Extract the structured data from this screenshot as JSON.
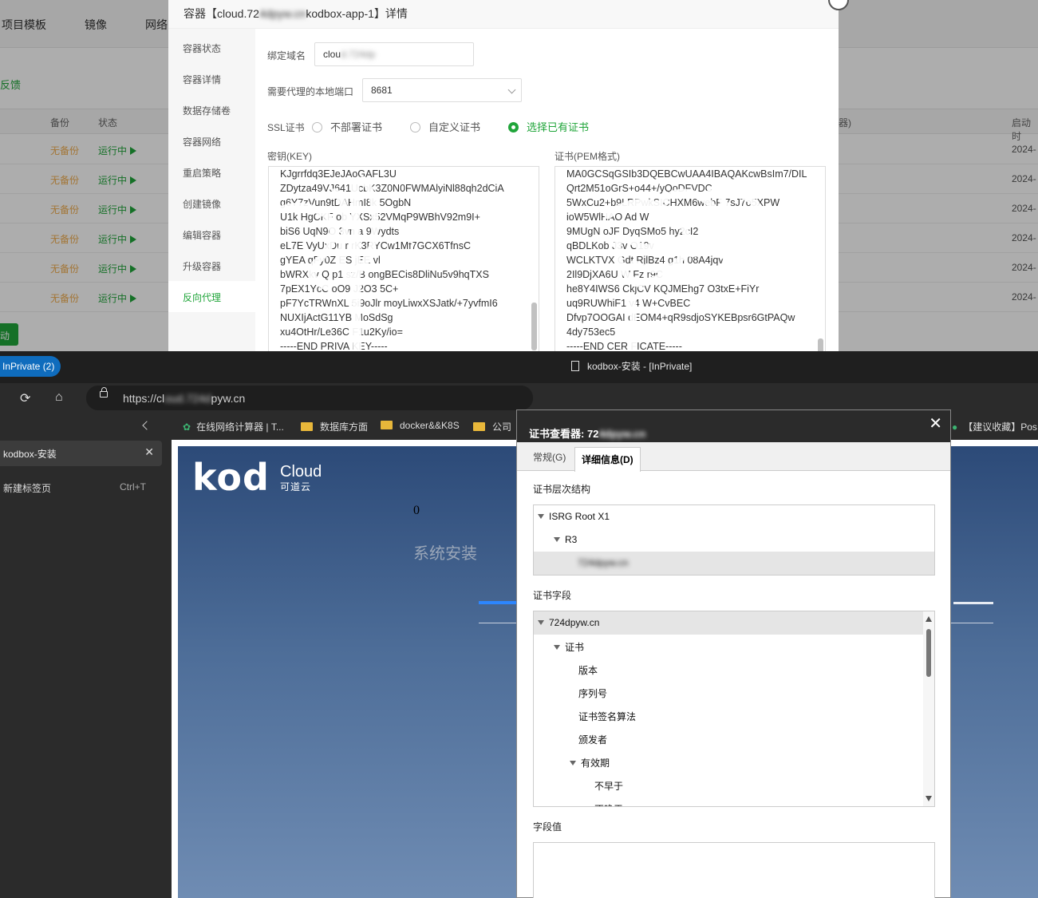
{
  "panel": {
    "nav": [
      "项目模板",
      "镜像",
      "网络"
    ],
    "feedback": "反馈",
    "table_headers": [
      "备份",
      "状态",
      "器)",
      "启动时"
    ],
    "rows": [
      {
        "backup": "无备份",
        "status": "运行中",
        "date": "2024-"
      },
      {
        "backup": "无备份",
        "status": "运行中",
        "date": "2024-"
      },
      {
        "backup": "无备份",
        "status": "运行中",
        "date": "2024-"
      },
      {
        "backup": "无备份",
        "status": "运行中",
        "date": "2024-"
      },
      {
        "backup": "无备份",
        "status": "运行中",
        "date": "2024-"
      },
      {
        "backup": "无备份",
        "status": "运行中",
        "date": "2024-"
      }
    ],
    "bottom_button": "动"
  },
  "modal": {
    "title_prefix": "容器【cloud.72",
    "title_blur": "4dpyw.cn",
    "title_suffix": "kodbox-app-1】详情",
    "sidebar": [
      "容器状态",
      "容器详情",
      "数据存储卷",
      "容器网络",
      "重启策略",
      "创建镜像",
      "编辑容器",
      "升级容器",
      "反向代理"
    ],
    "active_index": 8,
    "domain_label": "绑定域名",
    "domain_value_visible": "clou",
    "domain_value_blur": "d.724dp",
    "port_label": "需要代理的本地端口",
    "port_value": "8681",
    "ssl_label": "SSL证书",
    "ssl_options": [
      "不部署证书",
      "自定义证书",
      "选择已有证书"
    ],
    "ssl_selected": 2,
    "key_label": "密钥(KEY)",
    "key_lines": [
      "KJgrrfdq3EJeJAoGAFL3U",
      "ZDytza49VJ641UcbK3Z0N0FWMAlyiNl88qh2dCiA",
      "g6Y7zVun9tDAHmI8k  5OgbN",
      "  U1k  HgCKF  ob  YXSx52VMqP9WBhV92m9I+",
      "biS6  UqN9O  3vn  a  9Wydts",
      "eL7E  VyUxDu  r  rK3RYCw1Mf7GCX6TfnsC",
      "gYEA  qFy0Z  ES  jEE  vl",
      "bWRXkv  Q  p1  sz/B  ongBECis8DliNu5v9hqTXS",
      "7pEX1YcC  oO9  J2O3  5C+",
      "pF7YcTRWnXL  5i9oJlr moyLiwxXSJatk/+7yvfmI6",
      "NUXIjActG11YB  MoSdSg",
      "xu4OtHr/Le36C  F1u2Ky/io=",
      "-----END PRIVA  KEY-----"
    ],
    "cert_label": "证书(PEM格式)",
    "cert_lines": [
      "MA0GCSqGSIb3DQEBCwUAA4IBAQAKcwBsIm7/DIL",
      "Qrt2M51oGrS+o44+/yQoDFVDC",
      "5WxCu2+b9LRPwkSICHXM6webF  7sJ7o5XPW",
      "ioW5WlHAO  Ad  W",
      "9MUgN  oJF  DyqSMo5  hy2cI2",
      "qBDLKob  J3v  O19v",
      "WCLKTVX  Gdt  RjlBz4  g1h  08A4jqv",
      "2Il9DjXA6U  W  Fz  r9C",
      "he8Y4IWS6  CkjCV  KQJMEhg7  O3txE+FiYr",
      "uq9RUWhiF1  v4  W+CvBEC",
      "Dfvp7OOGAI  dEOM4+qR9sdjoSYKEBpsr6GtPAQw",
      "4dy753ec5",
      "-----END CER  FICATE-----"
    ]
  },
  "browser": {
    "inprivate": "InPrivate (2)",
    "window_title": "kodbox-安装 - [InPrivate]",
    "url_prefix": "https://cl",
    "url_blur": "oud.724d",
    "url_suffix": "pyw.cn",
    "bookmarks": [
      "在线网络计算器 | T...",
      "数据库方面",
      "docker&&K8S",
      "公司",
      "【建议收藏】Pos"
    ],
    "tab_title": "kodbox-安装",
    "new_tab": "新建标签页",
    "new_tab_shortcut": "Ctrl+T"
  },
  "webpage": {
    "logo": "kod",
    "logo_cloud": "Cloud",
    "logo_cn": "可道云",
    "zero": "0",
    "install": "系统安装"
  },
  "cert_viewer": {
    "title": "证书查看器: 72",
    "title_blur": "4dpyw.cn",
    "tabs": [
      "常规(G)",
      "详细信息(D)"
    ],
    "active_tab": 1,
    "hierarchy_label": "证书层次结构",
    "hierarchy": [
      "ISRG Root X1",
      "R3",
      "724dpyw.cn"
    ],
    "fields_label": "证书字段",
    "fields": [
      "724dpyw.cn",
      "证书",
      "版本",
      "序列号",
      "证书签名算法",
      "颁发者",
      "有效期",
      "不早于",
      "不晚于"
    ],
    "value_label": "字段值"
  },
  "icons": {
    "reload": "reload-icon",
    "home": "home-icon",
    "lock": "lock-icon",
    "bookmark": "gear-icon",
    "folder": "folder-icon"
  },
  "colors": {
    "brand_green": "#20a53a",
    "backup_orange": "#f0ad4e",
    "inprivate_blue": "#0f6cbd",
    "page_bg_top": "#2c4a78"
  }
}
